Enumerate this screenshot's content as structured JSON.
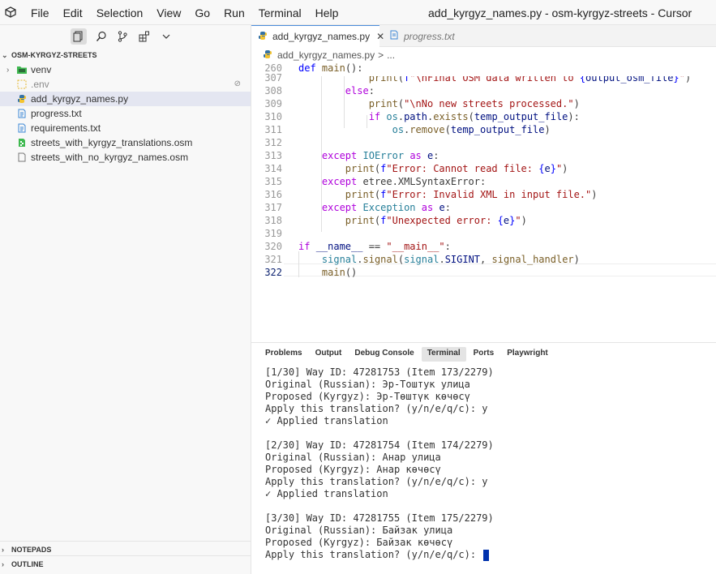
{
  "window": {
    "title": "add_kyrgyz_names.py - osm-kyrgyz-streets - Cursor"
  },
  "menu": [
    "File",
    "Edit",
    "Selection",
    "View",
    "Go",
    "Run",
    "Terminal",
    "Help"
  ],
  "explorer": {
    "root": "OSM-KYRGYZ-STREETS",
    "items": [
      {
        "label": "venv",
        "icon": "folder-icon"
      },
      {
        "label": ".env",
        "icon": "env-file-icon"
      },
      {
        "label": "add_kyrgyz_names.py",
        "icon": "python-file-icon"
      },
      {
        "label": "progress.txt",
        "icon": "text-file-icon"
      },
      {
        "label": "requirements.txt",
        "icon": "text-file-icon"
      },
      {
        "label": "streets_with_kyrgyz_translations.osm",
        "icon": "osm-file-icon"
      },
      {
        "label": "streets_with_no_kyrgyz_names.osm",
        "icon": "file-icon"
      }
    ],
    "sections": [
      "NOTEPADS",
      "OUTLINE"
    ]
  },
  "tabs": [
    {
      "label": "add_kyrgyz_names.py",
      "active": true
    },
    {
      "label": "progress.txt",
      "active": false
    }
  ],
  "breadcrumb": {
    "file": "add_kyrgyz_names.py",
    "sep": ">",
    "rest": "..."
  },
  "code": {
    "line_numbers": [
      "260",
      "307",
      "308",
      "309",
      "310",
      "311",
      "312",
      "313",
      "314",
      "315",
      "316",
      "317",
      "318",
      "319",
      "320",
      "321",
      "322"
    ],
    "current_line": "322"
  },
  "panel": {
    "tabs": [
      "Problems",
      "Output",
      "Debug Console",
      "Terminal",
      "Ports",
      "Playwright"
    ],
    "active_tab": "Terminal",
    "terminal_lines": [
      "[1/30] Way ID: 47281753 (Item 173/2279)",
      "Original (Russian): Эр-Тоштук улица",
      "Proposed (Kyrgyz): Эр-Төштүк көчөсү",
      "Apply this translation? (y/n/e/q/c): y",
      "✓ Applied translation",
      "",
      "[2/30] Way ID: 47281754 (Item 174/2279)",
      "Original (Russian): Анар улица",
      "Proposed (Kyrgyz): Анар көчөсү",
      "Apply this translation? (y/n/e/q/c): y",
      "✓ Applied translation",
      "",
      "[3/30] Way ID: 47281755 (Item 175/2279)",
      "Original (Russian): Байзак улица",
      "Proposed (Kyrgyz): Байзак көчөсү",
      "Apply this translation? (y/n/e/q/c): "
    ]
  },
  "colors": {
    "accent": "#4c8ddc",
    "cursor": "#0031ad",
    "selection": "#e4e6f1"
  }
}
